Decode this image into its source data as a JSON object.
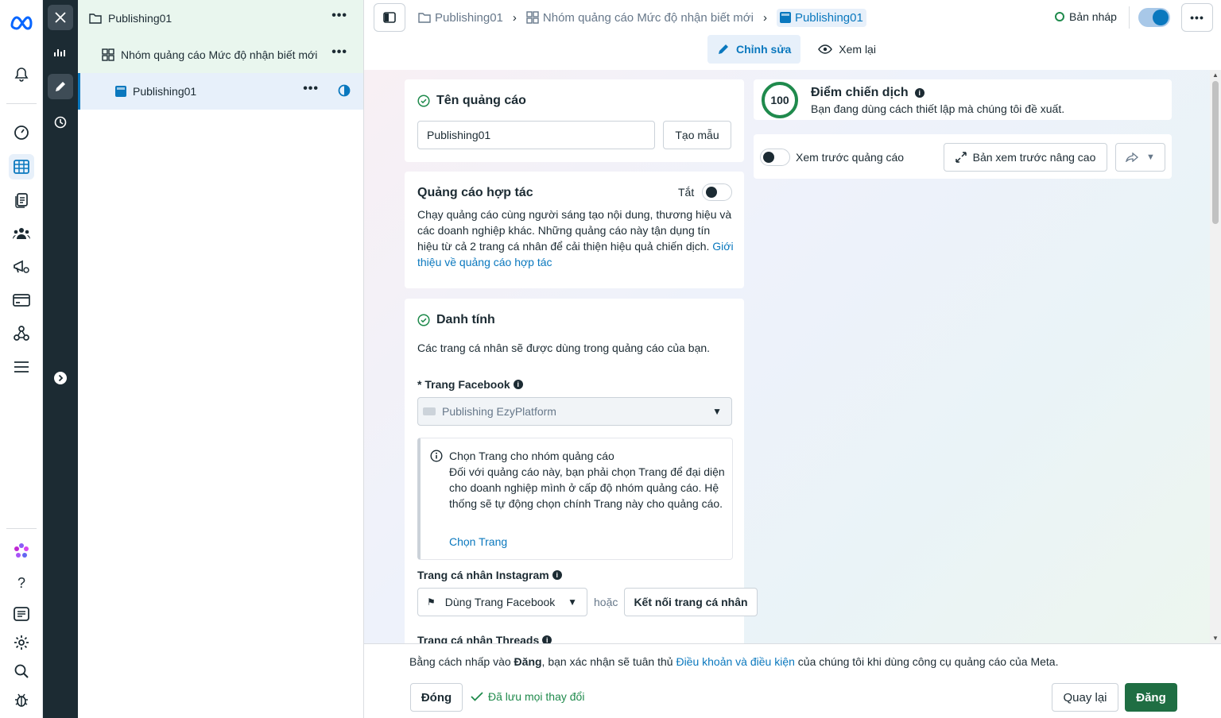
{
  "tree": {
    "campaign_name": "Publishing01",
    "adset_name": "Nhóm quảng cáo Mức độ nhận biết mới",
    "ad_name": "Publishing01"
  },
  "breadcrumb": {
    "campaign": "Publishing01",
    "adset": "Nhóm quảng cáo Mức độ nhận biết mới",
    "ad": "Publishing01"
  },
  "status": {
    "draft_label": "Bản nháp"
  },
  "tabs": {
    "edit": "Chỉnh sửa",
    "review": "Xem lại"
  },
  "ad_name_card": {
    "title": "Tên quảng cáo",
    "value": "Publishing01",
    "template_button": "Tạo mẫu"
  },
  "partnership": {
    "title": "Quảng cáo hợp tác",
    "toggle_label": "Tắt",
    "description": "Chạy quảng cáo cùng người sáng tạo nội dung, thương hiệu và các doanh nghiệp khác. Những quảng cáo này tận dụng tín hiệu từ cả 2 trang cá nhân để cải thiện hiệu quả chiến dịch.",
    "link": "Giới thiệu về quảng cáo hợp tác"
  },
  "identity": {
    "title": "Danh tính",
    "subtitle": "Các trang cá nhân sẽ được dùng trong quảng cáo của bạn.",
    "fb_label": "* Trang Facebook",
    "fb_value": "Publishing EzyPlatform",
    "notice_title": "Chọn Trang cho nhóm quảng cáo",
    "notice_body": "Đối với quảng cáo này, bạn phải chọn Trang để đại diện cho doanh nghiệp mình ở cấp độ nhóm quảng cáo. Hệ thống sẽ tự động chọn chính Trang này cho quảng cáo.",
    "notice_link": "Chọn Trang",
    "ig_label": "Trang cá nhân Instagram",
    "ig_value": "Dùng Trang Facebook",
    "or_label": "hoặc",
    "connect_button": "Kết nối trang cá nhân",
    "threads_label": "Trang cá nhân Threads"
  },
  "score": {
    "value": "100",
    "title": "Điểm chiến dịch",
    "subtitle": "Bạn đang dùng cách thiết lập mà chúng tôi đề xuất."
  },
  "preview": {
    "toggle_label": "Xem trước quảng cáo",
    "advanced_button": "Bản xem trước nâng cao"
  },
  "footer": {
    "terms_prefix": "Bằng cách nhấp vào ",
    "terms_bold": "Đăng",
    "terms_mid": ", bạn xác nhận sẽ tuân thủ ",
    "terms_link": "Điều khoản và điều kiện",
    "terms_suffix": " của chúng tôi khi dùng công cụ quảng cáo của Meta.",
    "close_button": "Đóng",
    "saved_status": "Đã lưu mọi thay đổi",
    "back_button": "Quay lại",
    "publish_button": "Đăng"
  },
  "colors": {
    "accent": "#0a78be",
    "success": "#1f8a4c",
    "publish": "#1f6e43",
    "dark_strip": "#1c2b33"
  }
}
